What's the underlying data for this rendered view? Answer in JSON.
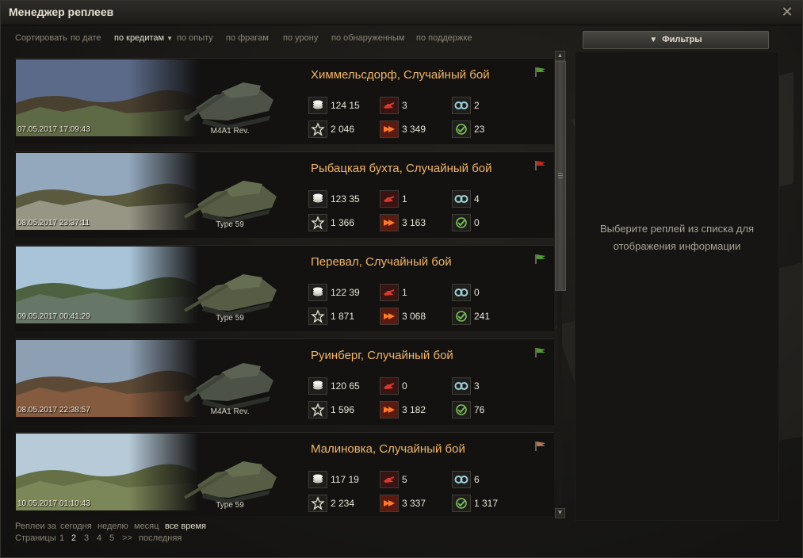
{
  "window": {
    "title": "Менеджер реплеев",
    "close_icon": "close-icon"
  },
  "sort": {
    "label": "Сортировать",
    "options": [
      "по дате",
      "по кредитам",
      "по опыту",
      "по фрагам",
      "по урону",
      "по обнаруженным",
      "по поддержке"
    ],
    "active": "по кредитам"
  },
  "filters": {
    "label": "Фильтры",
    "icon": "funnel-icon"
  },
  "replays": [
    {
      "date": "07.05.2017 17:09:43",
      "vehicle": "M4A1 Rev.",
      "map": "Химмельсдорф, Случайный бой",
      "flag_color": "#4f9a2e",
      "credits": "124 15",
      "kills": "3",
      "spotted": "2",
      "xp": "2 046",
      "damage": "3 349",
      "assist": "23",
      "thumb": {
        "sky": "#5b6a88",
        "ground": "#4a4030",
        "accent": "#6f8a57"
      }
    },
    {
      "date": "08.05.2017 23:37:11",
      "vehicle": "Type 59",
      "map": "Рыбацкая бухта, Случайный бой",
      "flag_color": "#c02a1c",
      "credits": "123 35",
      "kills": "1",
      "spotted": "4",
      "xp": "1 366",
      "damage": "3 163",
      "assist": "0",
      "thumb": {
        "sky": "#93a8bd",
        "ground": "#5b5a3e",
        "accent": "#c8c7bd"
      }
    },
    {
      "date": "09.05.2017 00:41:29",
      "vehicle": "Type 59",
      "map": "Перевал, Случайный бой",
      "flag_color": "#4f9a2e",
      "credits": "122 39",
      "kills": "1",
      "spotted": "0",
      "xp": "1 871",
      "damage": "3 068",
      "assist": "241",
      "thumb": {
        "sky": "#a9c4d9",
        "ground": "#4e6140",
        "accent": "#7c8a87"
      }
    },
    {
      "date": "08.05.2017 22:38:57",
      "vehicle": "M4A1 Rev.",
      "map": "Руинберг, Случайный бой",
      "flag_color": "#4f9a2e",
      "credits": "120 65",
      "kills": "0",
      "spotted": "3",
      "xp": "1 596",
      "damage": "3 182",
      "assist": "76",
      "thumb": {
        "sky": "#8da0b3",
        "ground": "#5d4a36",
        "accent": "#a66a48"
      }
    },
    {
      "date": "10.05.2017 01:10:43",
      "vehicle": "Type 59",
      "map": "Малиновка, Случайный бой",
      "flag_color": "#b0745a",
      "credits": "117 19",
      "kills": "5",
      "spotted": "6",
      "xp": "2 234",
      "damage": "3 337",
      "assist": "1 317",
      "thumb": {
        "sky": "#b6cad8",
        "ground": "#667046",
        "accent": "#8e9a6a"
      }
    }
  ],
  "details": {
    "hint_line1": "Выберите реплей из списка для",
    "hint_line2": "отображения информации"
  },
  "period": {
    "label": "Реплеи за",
    "options": [
      "сегодня",
      "неделю",
      "месяц",
      "все время"
    ],
    "active": "все время"
  },
  "pages": {
    "label": "Страницы",
    "items": [
      "1",
      "2",
      "3",
      "4",
      "5",
      ">>",
      "последняя"
    ],
    "active": "2"
  }
}
